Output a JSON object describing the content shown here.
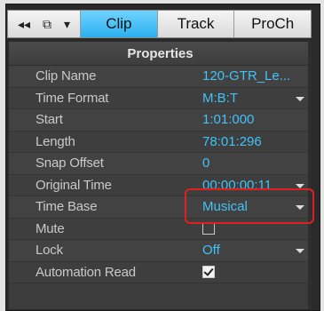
{
  "tabbar": {
    "tools": [
      "◂◂",
      "⧉",
      "▾"
    ],
    "tabs": [
      {
        "label": "Clip",
        "active": true
      },
      {
        "label": "Track",
        "active": false
      },
      {
        "label": "ProCh",
        "active": false
      }
    ]
  },
  "panel": {
    "title": "Properties",
    "rows": [
      {
        "label": "Clip Name",
        "value": "120-GTR_Le...",
        "dropdown": false
      },
      {
        "label": "Time Format",
        "value": "M:B:T",
        "dropdown": true
      },
      {
        "label": "Start",
        "value": "1:01:000",
        "dropdown": false
      },
      {
        "label": "Length",
        "value": "78:01:296",
        "dropdown": false
      },
      {
        "label": "Snap Offset",
        "value": "0",
        "dropdown": false
      },
      {
        "label": "Original Time",
        "value": "00:00:00:11",
        "dropdown": true
      },
      {
        "label": "Time Base",
        "value": "Musical",
        "dropdown": true
      },
      {
        "label": "Mute",
        "value": "",
        "checkbox": false
      },
      {
        "label": "Lock",
        "value": "Off",
        "dropdown": true
      },
      {
        "label": "Automation Read",
        "value": "",
        "checkbox": true
      }
    ]
  },
  "colors": {
    "accent_tab": "#2bb0ee",
    "value_text": "#41c3f6",
    "highlight": "#e02020"
  }
}
